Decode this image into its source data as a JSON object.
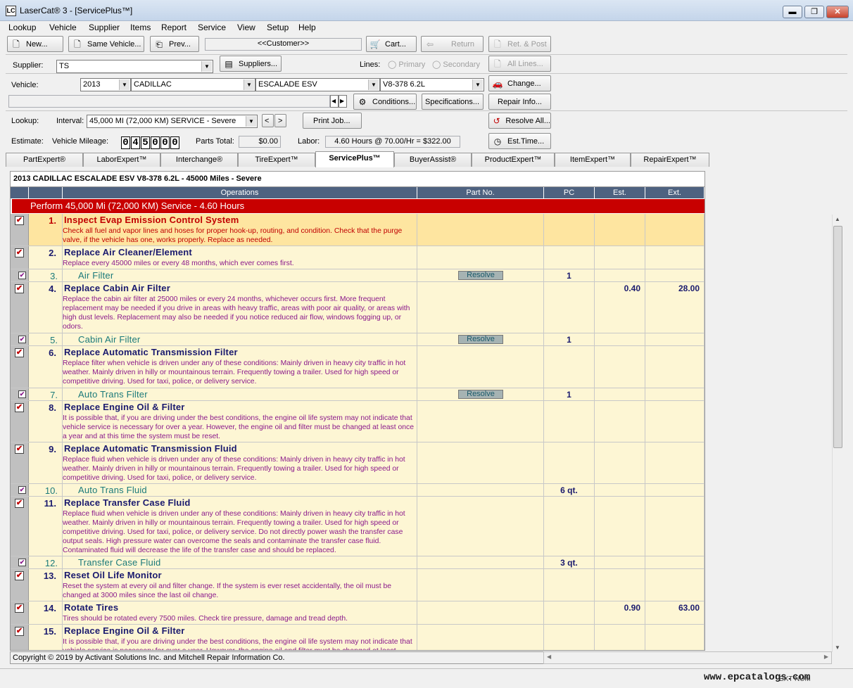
{
  "window": {
    "title": "LaserCat® 3 - [ServicePlus™]",
    "app_icon": "LC",
    "min": "▬",
    "max": "❐",
    "close": "✕"
  },
  "menu": [
    "Lookup",
    "Vehicle",
    "Supplier",
    "Items",
    "Report",
    "Service",
    "View",
    "Setup",
    "Help"
  ],
  "toolbar": {
    "new": "New...",
    "same_vehicle": "Same Vehicle...",
    "prev": "Prev...",
    "customer": "<<Customer>>",
    "cart": "Cart...",
    "return": "Return",
    "ret_post": "Ret. & Post"
  },
  "supplier": {
    "label": "Supplier:",
    "value": "TS",
    "button": "Suppliers..."
  },
  "lines": {
    "label": "Lines:",
    "primary": "Primary",
    "secondary": "Secondary",
    "all_lines": "All Lines..."
  },
  "vehicle": {
    "label": "Vehicle:",
    "year": "2013",
    "make": "CADILLAC",
    "model": "ESCALADE ESV",
    "engine": "V8-378  6.2L",
    "change": "Change...",
    "conditions": "Conditions...",
    "specifications": "Specifications...",
    "repair_info": "Repair Info..."
  },
  "lookup": {
    "label": "Lookup:",
    "interval_label": "Interval:",
    "interval_value": "45,000 MI (72,000 KM) SERVICE - Severe",
    "print_job": "Print Job...",
    "resolve_all": "Resolve All..."
  },
  "estimate": {
    "label": "Estimate:",
    "mileage_label": "Vehicle Mileage:",
    "mileage_digits": [
      "0",
      "4",
      "5",
      "0",
      "0",
      "0"
    ],
    "parts_total_label": "Parts Total:",
    "parts_total": "$0.00",
    "labor_label": "Labor:",
    "labor_value": "4.60 Hours @ 70.00/Hr = $322.00",
    "est_time": "Est.Time..."
  },
  "tabs": [
    "PartExpert®",
    "LaborExpert™",
    "Interchange®",
    "TireExpert™",
    "ServicePlus™",
    "BuyerAssist®",
    "ProductExpert™",
    "ItemExpert™",
    "RepairExpert™"
  ],
  "active_tab": "ServicePlus™",
  "grid": {
    "vehicle_title": "2013 CADILLAC ESCALADE ESV V8-378  6.2L  - 45000 Miles  - Severe",
    "columns": {
      "operations": "Operations",
      "part_no": "Part No.",
      "pc": "PC",
      "est": "Est.",
      "ext": "Ext."
    },
    "perform": "Perform 45,000 Mi (72,000 KM) Service - 4.60 Hours",
    "resolve_label": "Resolve",
    "check_mark": "✔",
    "rows": [
      {
        "num": "1.",
        "title": "Inspect Evap Emission Control System",
        "desc": "Check all fuel and vapor lines and hoses for proper hook-up, routing, and condition. Check that the purge valve, if the vehicle has one, works properly. Replace as needed.",
        "pc": "",
        "est": "",
        "ext": ""
      },
      {
        "num": "2.",
        "title": "Replace Air Cleaner/Element",
        "desc": "Replace every 45000 miles or every 48 months, which ever comes first.",
        "pc": "",
        "est": "",
        "ext": ""
      },
      {
        "num": "3.",
        "title": "Air Filter",
        "desc": "",
        "pc": "1",
        "est": "",
        "ext": ""
      },
      {
        "num": "4.",
        "title": "Replace Cabin Air Filter",
        "desc": "Replace the cabin air filter at 25000 miles or every 24 months, whichever occurs first. More frequent replacement may be needed if you drive in areas with heavy traffic, areas with poor air quality, or areas with high dust levels. Replacement may also be needed if you notice reduced air flow, windows fogging up, or odors.",
        "pc": "",
        "est": "0.40",
        "ext": "28.00"
      },
      {
        "num": "5.",
        "title": "Cabin Air Filter",
        "desc": "",
        "pc": "1",
        "est": "",
        "ext": ""
      },
      {
        "num": "6.",
        "title": "Replace Automatic Transmission Filter",
        "desc": "Replace filter when vehicle is driven under any of these conditions: Mainly driven in heavy city traffic in hot weather. Mainly driven in hilly or mountainous terrain. Frequently towing a trailer. Used for high speed or competitive driving. Used for taxi, police, or delivery service.",
        "pc": "",
        "est": "",
        "ext": ""
      },
      {
        "num": "7.",
        "title": "Auto Trans Filter",
        "desc": "",
        "pc": "1",
        "est": "",
        "ext": ""
      },
      {
        "num": "8.",
        "title": "Replace Engine Oil & Filter",
        "desc": "It is possible that, if you are driving under the best conditions, the engine oil life system may not indicate that vehicle service is necessary for over a year. However, the engine oil and filter must be changed at least once a year and at this time the system must be reset.",
        "pc": "",
        "est": "",
        "ext": ""
      },
      {
        "num": "9.",
        "title": "Replace Automatic Transmission Fluid",
        "desc": "Replace fluid when vehicle is driven under any of these conditions: Mainly driven in heavy city traffic in hot weather. Mainly driven in hilly or mountainous terrain. Frequently towing a trailer. Used for high speed or competitive driving. Used for taxi, police, or delivery service.",
        "pc": "",
        "est": "",
        "ext": ""
      },
      {
        "num": "10.",
        "title": "Auto Trans Fluid",
        "desc": "",
        "pc": "6 qt.",
        "est": "",
        "ext": ""
      },
      {
        "num": "11.",
        "title": "Replace Transfer Case Fluid",
        "desc": "Replace fluid when vehicle is driven under any of these conditions: Mainly driven in heavy city traffic in hot weather. Mainly driven in hilly or mountainous terrain. Frequently towing a trailer. Used for high speed or competitive driving. Used for taxi, police, or delivery service. Do not directly power wash the transfer case output seals. High pressure water can overcome the seals and contaminate the transfer case fluid. Contaminated fluid will decrease the life of the transfer case and should be replaced.",
        "pc": "",
        "est": "",
        "ext": ""
      },
      {
        "num": "12.",
        "title": "Transfer Case Fluid",
        "desc": "",
        "pc": "3 qt.",
        "est": "",
        "ext": ""
      },
      {
        "num": "13.",
        "title": "Reset Oil Life Monitor",
        "desc": "Reset the system at every oil and filter change. If the system is ever reset accidentally, the oil must be changed at 3000 miles since the last oil change.",
        "pc": "",
        "est": "",
        "ext": ""
      },
      {
        "num": "14.",
        "title": "Rotate Tires",
        "desc": "Tires should be rotated every 7500 miles. Check tire pressure, damage and tread depth.",
        "pc": "",
        "est": "0.90",
        "ext": "63.00"
      },
      {
        "num": "15.",
        "title": "Replace Engine Oil & Filter",
        "desc": "It is possible that, if you are driving under the best conditions, the engine oil life system may not indicate that vehicle service is necessary for over a year. However, the engine oil and filter must be changed at least",
        "pc": "",
        "est": "",
        "ext": ""
      }
    ]
  },
  "footer": {
    "copyright": "Copyright © 2019 by Activant Solutions Inc. and Mitchell Repair Information Co."
  },
  "status": {
    "watermark": "www.epcatalogs.com",
    "ext_num": "EXT NUM"
  },
  "colors": {
    "perform_bar": "#c80000",
    "column_header": "#4e6280",
    "row_bg": "#fdf6d4",
    "highlight_row": "#fee5a0"
  }
}
